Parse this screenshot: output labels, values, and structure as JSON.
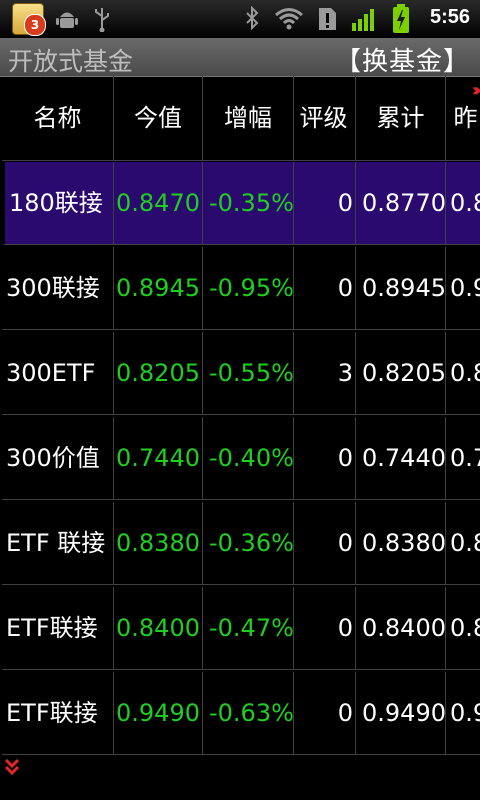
{
  "status_bar": {
    "notification_count": "3",
    "time": "5:56"
  },
  "title_bar": {
    "title": "开放式基金",
    "switch_button": "【换基金】"
  },
  "table": {
    "headers": [
      "名称",
      "今值",
      "增幅",
      "评级",
      "累计",
      "昨"
    ],
    "rows": [
      {
        "name": "180联接",
        "value": "0.8470",
        "change": "-0.35%",
        "rating": "0",
        "cumulative": "0.8770",
        "prev": "0.8"
      },
      {
        "name": "300联接",
        "value": "0.8945",
        "change": "-0.95%",
        "rating": "0",
        "cumulative": "0.8945",
        "prev": "0.9"
      },
      {
        "name": "300ETF",
        "value": "0.8205",
        "change": "-0.55%",
        "rating": "3",
        "cumulative": "0.8205",
        "prev": "0.8"
      },
      {
        "name": "300价值",
        "value": "0.7440",
        "change": "-0.40%",
        "rating": "0",
        "cumulative": "0.7440",
        "prev": "0.7"
      },
      {
        "name": "ETF 联接",
        "value": "0.8380",
        "change": "-0.36%",
        "rating": "0",
        "cumulative": "0.8380",
        "prev": "0.8"
      },
      {
        "name": "ETF联接",
        "value": "0.8400",
        "change": "-0.47%",
        "rating": "0",
        "cumulative": "0.8400",
        "prev": "0.8"
      },
      {
        "name": "ETF联接",
        "value": "0.9490",
        "change": "-0.63%",
        "rating": "0",
        "cumulative": "0.9490",
        "prev": "0.9"
      }
    ],
    "selected_row": 0
  },
  "colors": {
    "value_green": "#1fcf1f",
    "selected_bg": "#2a0a6e",
    "arrow_red": "#e0262a"
  },
  "icons": [
    "notification-app-icon",
    "android-debug-icon",
    "usb-icon",
    "bluetooth-icon",
    "wifi-icon",
    "alert-icon",
    "signal-icon",
    "battery-charging-icon",
    "scroll-right-icon",
    "scroll-down-icon"
  ]
}
